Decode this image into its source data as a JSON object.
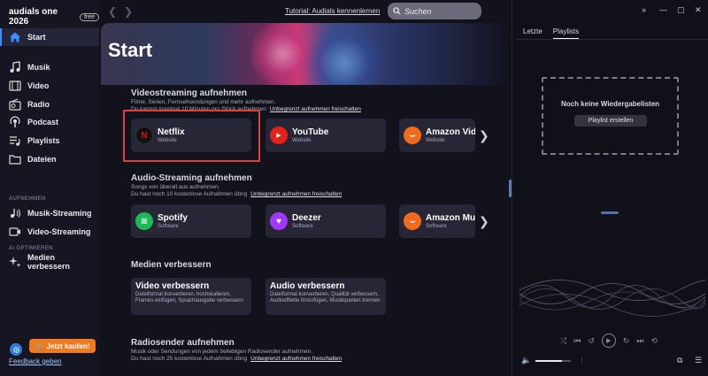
{
  "app": {
    "brand": "audials one 2026",
    "badge": "free"
  },
  "sidebar": {
    "items": [
      {
        "label": "Start",
        "icon": "home-icon"
      },
      {
        "label": "Musik",
        "icon": "music-icon"
      },
      {
        "label": "Video",
        "icon": "film-icon"
      },
      {
        "label": "Radio",
        "icon": "radio-icon"
      },
      {
        "label": "Podcast",
        "icon": "podcast-icon"
      },
      {
        "label": "Playlists",
        "icon": "playlist-icon"
      },
      {
        "label": "Dateien",
        "icon": "folder-icon"
      }
    ],
    "record_label": "AUFNEHMEN",
    "record_items": [
      {
        "label": "Musik-Streaming",
        "icon": "music-stream-icon"
      },
      {
        "label": "Video-Streaming",
        "icon": "video-stream-icon"
      }
    ],
    "ai_label": "AI OPTIMIEREN",
    "ai_items": [
      {
        "label": "Medien verbessern",
        "icon": "sparkle-icon"
      }
    ],
    "buy_label": "Jetzt kaufen!",
    "feedback_label": "Feedback geben"
  },
  "topbar": {
    "tutorial_link": "Tutorial: Audials kennenlernen",
    "search_placeholder": "Suchen"
  },
  "hero": {
    "title": "Start"
  },
  "video_section": {
    "title": "Videostreaming aufnehmen",
    "sub1": "Filme, Serien, Fernsehsendungen und mehr aufnehmen.",
    "sub2": "Du kannst maximal 10 Minuten pro Stück aufnehmen",
    "link": "Unbegrenzt aufnehmen freischalten",
    "cards": [
      {
        "name": "Netflix",
        "type": "Website",
        "color": "#1a1a1a",
        "glyph": "N"
      },
      {
        "name": "YouTube",
        "type": "Website",
        "color": "#e62117",
        "glyph": "▶"
      },
      {
        "name": "Amazon Video",
        "type": "Website",
        "color": "#f26a1b",
        "glyph": "⌣"
      }
    ]
  },
  "audio_section": {
    "title": "Audio-Streaming aufnehmen",
    "sub1": "Songs von überall aus aufnehmen.",
    "sub2": "Du hast noch 10 kostenlose Aufnahmen übrig",
    "link": "Unbegrenzt aufnehmen freischalten",
    "cards": [
      {
        "name": "Spotify",
        "type": "Software",
        "color": "#1db954",
        "glyph": "≋"
      },
      {
        "name": "Deezer",
        "type": "Software",
        "color": "#a238ff",
        "glyph": "♥"
      },
      {
        "name": "Amazon Music",
        "type": "Software",
        "color": "#f26a1b",
        "glyph": "⌣"
      }
    ]
  },
  "improve_section": {
    "title": "Medien verbessern",
    "cards": [
      {
        "title": "Video verbessern",
        "desc": "Dateiformat konvertieren, hochskalieren, Frames einfügen, Sprachausgabe verbessern"
      },
      {
        "title": "Audio verbessern",
        "desc": "Dateiformat konvertieren, Qualität verbessern, Audioeffekte hinzufügen, Musikquellen trennen"
      }
    ]
  },
  "radio_section": {
    "title": "Radiosender aufnehmen",
    "sub1": "Musik oder Sendungen von jedem beliebigen Radiosender aufnehmen.",
    "sub2": "Du hast noch 25 kostenlose Aufnahmen übrig",
    "link": "Unbegrenzt aufnehmen freischalten"
  },
  "right_panel": {
    "tabs": [
      "Letzte",
      "Playlists"
    ],
    "active_tab": "Playlists",
    "empty_title": "Noch keine Wiedergabelisten",
    "create_button": "Playlist erstellen",
    "volume": 0.75
  }
}
